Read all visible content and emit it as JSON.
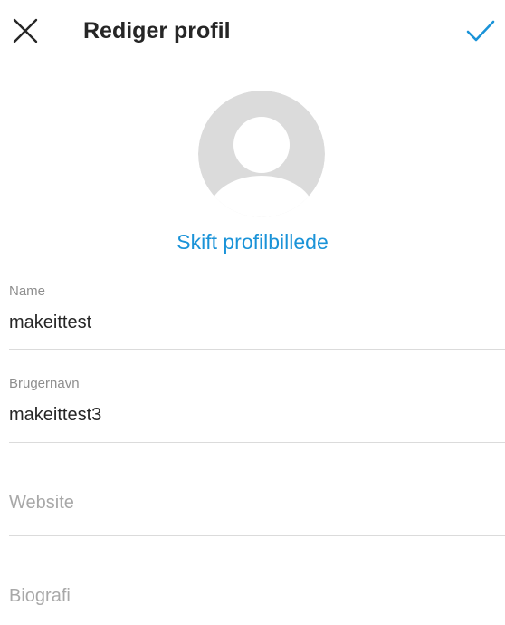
{
  "header": {
    "title": "Rediger profil",
    "close_icon": "close-icon",
    "confirm_icon": "checkmark-icon",
    "accent_color": "#1a93d8"
  },
  "avatar": {
    "icon": "default-avatar-icon",
    "change_label": "Skift profilbillede"
  },
  "fields": {
    "name": {
      "label": "Name",
      "value": "makeittest"
    },
    "username": {
      "label": "Brugernavn",
      "value": "makeittest3"
    },
    "website": {
      "placeholder": "Website"
    },
    "bio": {
      "placeholder": "Biografi"
    }
  }
}
